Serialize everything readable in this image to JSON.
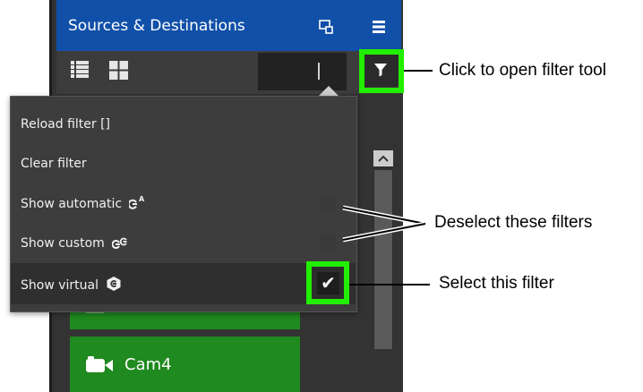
{
  "panel": {
    "title": "Sources & Destinations",
    "header_color": "#1150a8"
  },
  "toolbar": {
    "search_value": "",
    "view_list_icon": "list-view-icon",
    "view_grid_icon": "grid-view-icon",
    "filter_icon": "filter-icon"
  },
  "filter_menu": {
    "items": [
      {
        "label": "Reload filter []"
      },
      {
        "label": "Clear filter"
      },
      {
        "label": "Show automatic"
      },
      {
        "label": "Show custom"
      },
      {
        "label": "Show virtual"
      }
    ],
    "show_virtual_checked": true
  },
  "list": {
    "items": [
      {
        "label": "Cam4",
        "icon": "camera-icon"
      }
    ]
  },
  "annotations": {
    "filter_tool": "Click to open filter tool",
    "deselect": "Deselect these filters",
    "select": "Select this filter"
  },
  "colors": {
    "highlight": "#22ee00",
    "item_green": "#1f8a1f",
    "panel_bg": "#333333"
  }
}
